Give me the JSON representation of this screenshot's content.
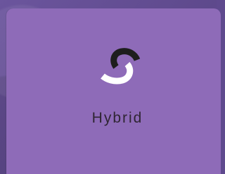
{
  "card": {
    "label": "Hybrid",
    "icon": "hybrid-swirl-icon"
  },
  "colors": {
    "card_background": "#8e6bb8",
    "label_text": "#2f2533",
    "icon_dark": "#1e1e1e",
    "icon_light": "#ffffff"
  }
}
